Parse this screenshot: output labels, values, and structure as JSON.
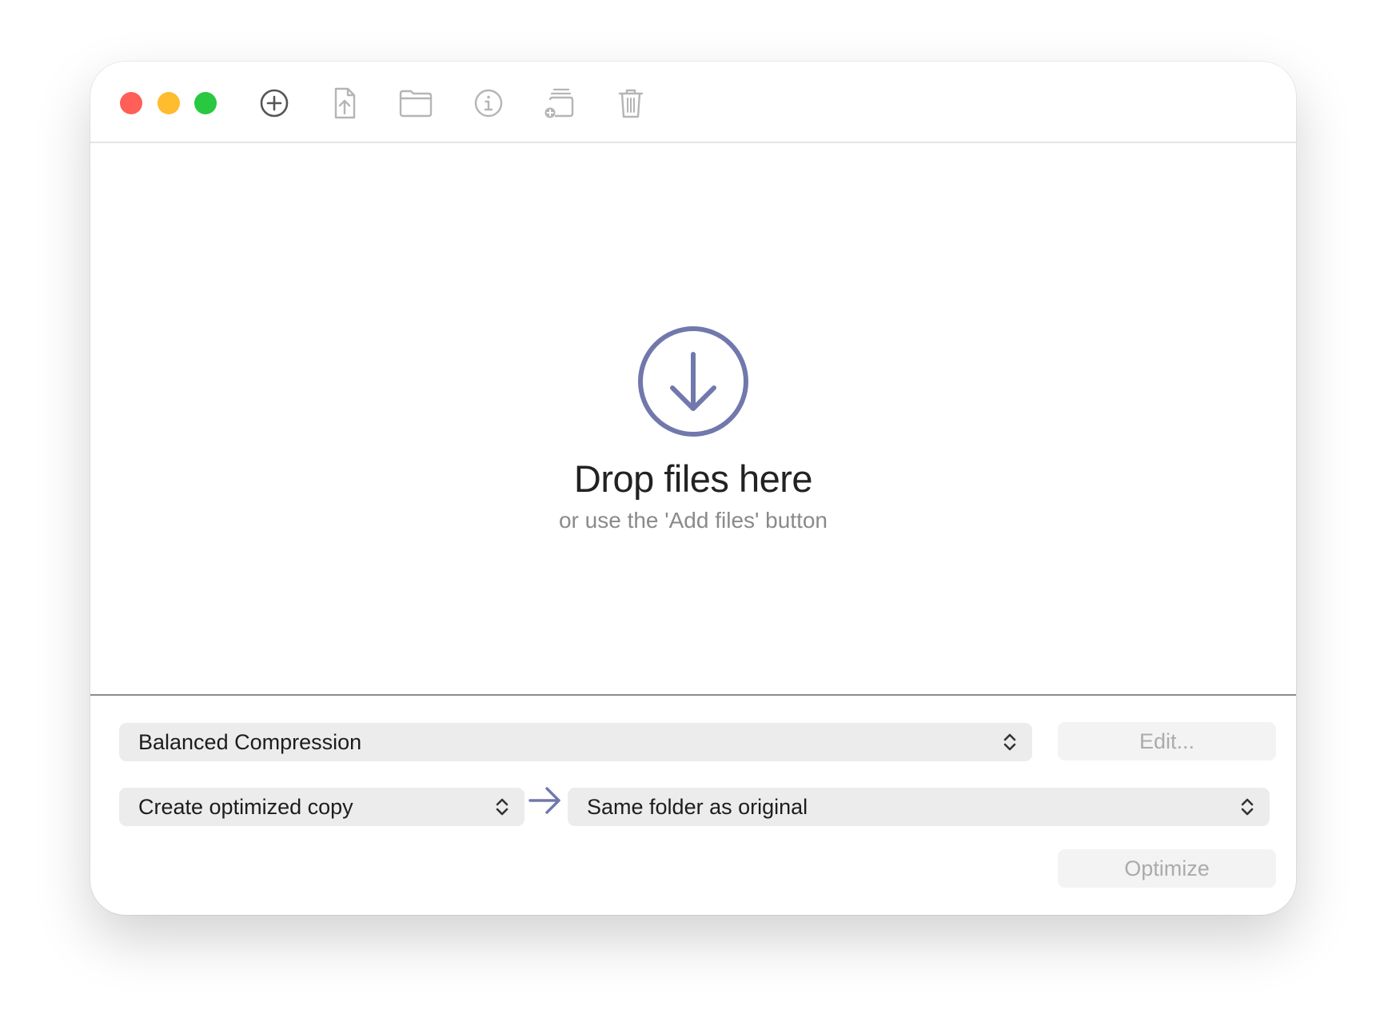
{
  "window": {
    "traffic_lights": {
      "close_color": "#fe5f57",
      "minimize_color": "#febc2e",
      "zoom_color": "#28c840"
    },
    "toolbar": {
      "icons": [
        "add-icon",
        "export-file-icon",
        "folder-icon",
        "info-icon",
        "add-to-stack-icon",
        "trash-icon"
      ]
    }
  },
  "dropzone": {
    "icon": "download-circle-icon",
    "accent_color": "#7078ac",
    "title": "Drop files here",
    "subtitle": "or use the 'Add files' button"
  },
  "controls": {
    "preset_select": {
      "value": "Balanced Compression"
    },
    "edit_button": {
      "label": "Edit..."
    },
    "action_select": {
      "value": "Create optimized copy"
    },
    "destination_select": {
      "value": "Same folder as original"
    },
    "optimize_button": {
      "label": "Optimize"
    }
  }
}
